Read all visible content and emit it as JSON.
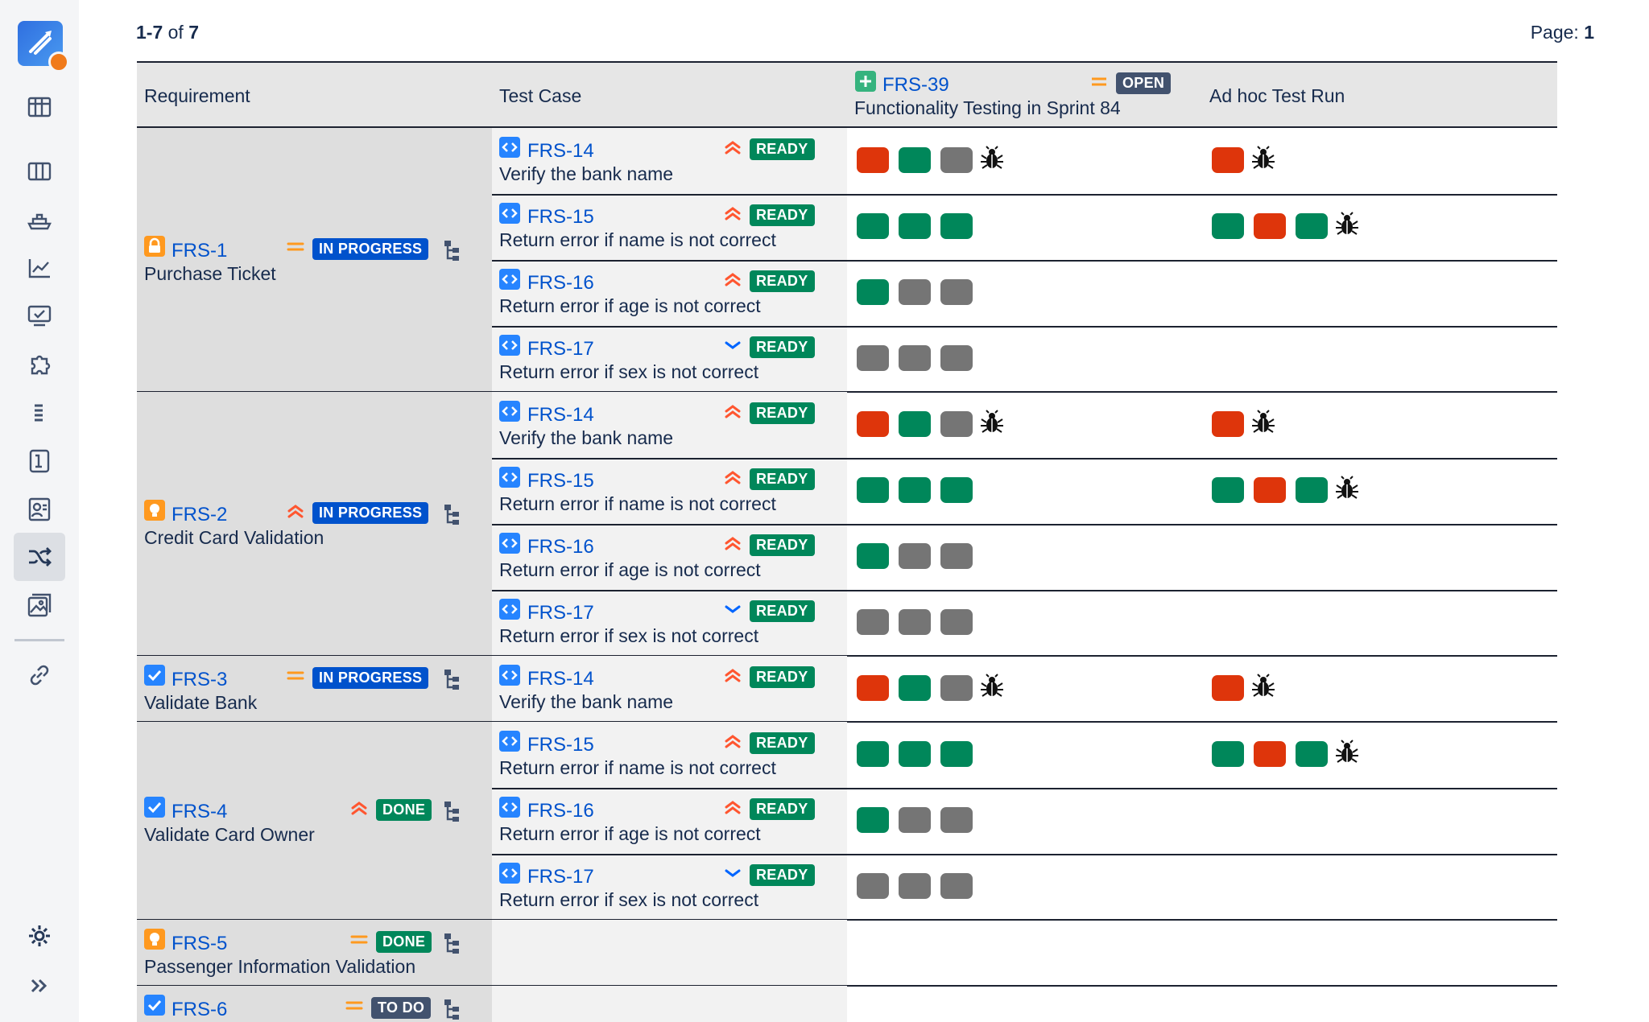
{
  "header": {
    "range": "1-7",
    "of_label": "of",
    "total": "7",
    "page_label": "Page:",
    "page": "1"
  },
  "sidebar": {
    "items": [
      "logo-icon",
      "board-icon",
      "columns-icon",
      "ship-icon",
      "chart-icon",
      "monitor-icon",
      "puzzle-icon",
      "list-icon",
      "book-icon",
      "contact-icon",
      "shuffle-icon",
      "gallery-icon",
      "link-icon",
      "settings-icon",
      "expand-icon"
    ],
    "active": "shuffle-icon"
  },
  "columns": {
    "requirement": "Requirement",
    "test_case": "Test Case",
    "cycle_key": "FRS-39",
    "cycle_status": "OPEN",
    "cycle_title": "Functionality Testing in Sprint 84",
    "adhoc": "Ad hoc Test Run"
  },
  "requirements": [
    {
      "key": "FRS-1",
      "title": "Purchase Ticket",
      "status": "IN PROGRESS",
      "priority": "medium",
      "type": "lock"
    },
    {
      "key": "FRS-2",
      "title": "Credit Card Validation",
      "status": "IN PROGRESS",
      "priority": "high",
      "type": "idea"
    },
    {
      "key": "FRS-3",
      "title": "Validate Bank",
      "status": "IN PROGRESS",
      "priority": "medium",
      "type": "check"
    },
    {
      "key": "FRS-4",
      "title": "Validate Card Owner",
      "status": "DONE",
      "priority": "high",
      "type": "check"
    },
    {
      "key": "FRS-5",
      "title": "Passenger Information Validation",
      "status": "DONE",
      "priority": "medium",
      "type": "idea"
    },
    {
      "key": "FRS-6",
      "title": "",
      "status": "TO DO",
      "priority": "medium",
      "type": "check"
    }
  ],
  "test_cases": [
    {
      "key": "FRS-14",
      "title": "Verify the bank name",
      "status": "READY",
      "priority": "high"
    },
    {
      "key": "FRS-15",
      "title": "Return error if name is not correct",
      "status": "READY",
      "priority": "high"
    },
    {
      "key": "FRS-16",
      "title": "Return error if age is not correct",
      "status": "READY",
      "priority": "high"
    },
    {
      "key": "FRS-17",
      "title": "Return error if sex is not correct",
      "status": "READY",
      "priority": "low"
    }
  ],
  "runs": {
    "FRS-14": {
      "cycle": [
        "fail",
        "pass",
        "none"
      ],
      "cycle_bug": true,
      "adhoc": [
        "fail"
      ],
      "adhoc_bug": true
    },
    "FRS-15": {
      "cycle": [
        "pass",
        "pass",
        "pass"
      ],
      "cycle_bug": false,
      "adhoc": [
        "pass",
        "fail",
        "pass"
      ],
      "adhoc_bug": true
    },
    "FRS-16": {
      "cycle": [
        "pass",
        "none",
        "none"
      ],
      "cycle_bug": false,
      "adhoc": [],
      "adhoc_bug": false
    },
    "FRS-17": {
      "cycle": [
        "none",
        "none",
        "none"
      ],
      "cycle_bug": false,
      "adhoc": [],
      "adhoc_bug": false
    }
  },
  "colors": {
    "pass": "#00875a",
    "fail": "#de350b",
    "none": "#757575",
    "link": "#0052cc"
  }
}
